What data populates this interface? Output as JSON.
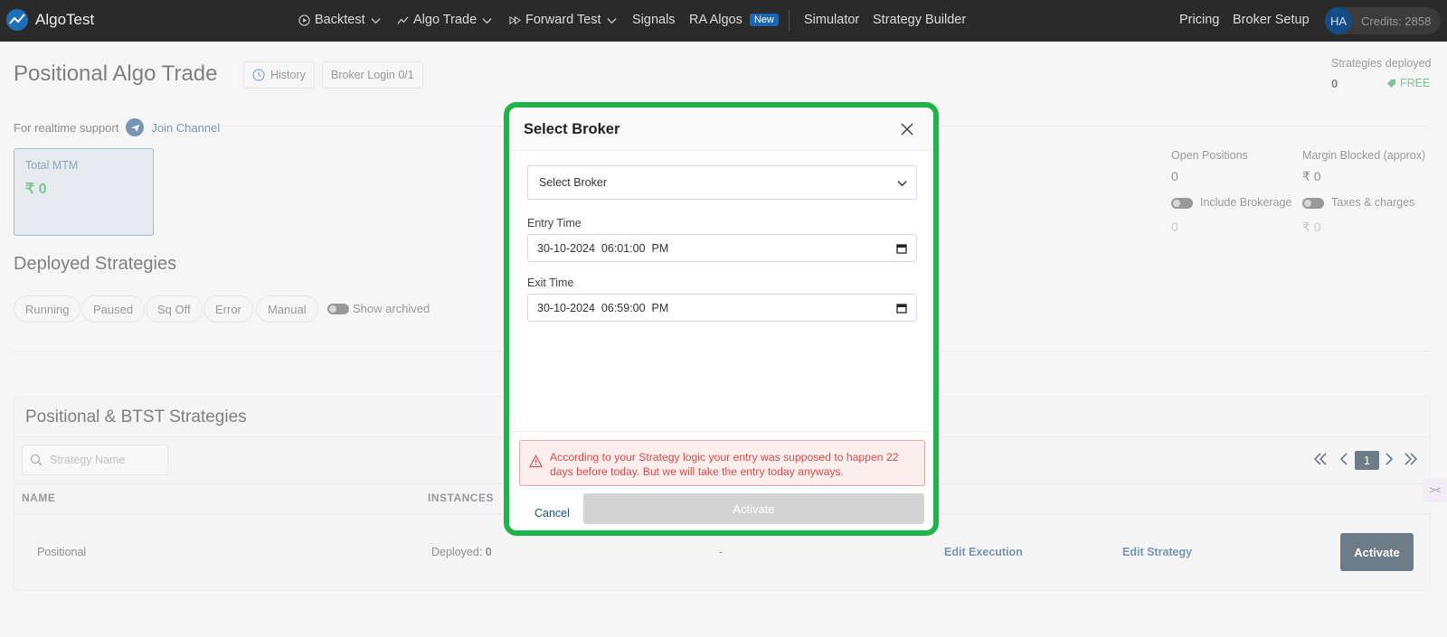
{
  "nav": {
    "brand": "AlgoTest",
    "items": [
      {
        "label": "Backtest",
        "icon": "play-circle-icon",
        "dropdown": true
      },
      {
        "label": "Algo Trade",
        "icon": "trend-icon",
        "dropdown": true
      },
      {
        "label": "Forward Test",
        "icon": "fast-forward-icon",
        "dropdown": true
      },
      {
        "label": "Signals"
      },
      {
        "label": "RA Algos",
        "badge": "New"
      },
      {
        "label": "Simulator"
      },
      {
        "label": "Strategy Builder"
      }
    ],
    "pricing": "Pricing",
    "broker_setup": "Broker Setup",
    "avatar": "HA",
    "credits": "Credits: 2858"
  },
  "header": {
    "title": "Positional Algo Trade",
    "history": "History",
    "broker_login": "Broker Login 0/1",
    "deployed_label": "Strategies deployed",
    "deployed_count": "0",
    "plan": "FREE"
  },
  "support": {
    "text": "For realtime support",
    "link": "Join Channel"
  },
  "mtm": {
    "label": "Total MTM",
    "value": "₹ 0"
  },
  "stats": {
    "open_positions_label": "Open Positions",
    "open_positions_value": "0",
    "margin_label": "Margin Blocked (approx)",
    "margin_value": "₹ 0",
    "include_brokerage": "Include Brokerage",
    "taxes": "Taxes & charges",
    "brokerage_value": "0",
    "taxes_value": "₹ 0"
  },
  "deployed": {
    "title": "Deployed Strategies",
    "filters": [
      "Running",
      "Paused",
      "Sq Off",
      "Error",
      "Manual"
    ],
    "show_archived": "Show archived"
  },
  "strategies": {
    "title": "Positional & BTST Strategies",
    "search_placeholder": "Strategy Name",
    "page": "1",
    "columns": [
      "NAME",
      "INSTANCES"
    ],
    "row": {
      "name": "Positional",
      "deployed_label": "Deployed:",
      "deployed_value": "0",
      "dash": "-",
      "edit_execution": "Edit Execution",
      "edit_strategy": "Edit Strategy",
      "activate": "Activate"
    }
  },
  "modal": {
    "title": "Select Broker",
    "select_placeholder": "Select Broker",
    "entry_label": "Entry Time",
    "entry_value": "30-10-2024  06:01:00  PM",
    "exit_label": "Exit Time",
    "exit_value": "30-10-2024  06:59:00  PM",
    "warning": "According to your Strategy logic your entry was supposed to happen 22 days before today. But we will take the entry today anyways.",
    "cancel": "Cancel",
    "activate": "Activate"
  },
  "colors": {
    "accent_green": "#1fb44a",
    "navy": "#0c2637",
    "link_blue": "#1d4f80",
    "warning_red": "#d94a4a"
  }
}
